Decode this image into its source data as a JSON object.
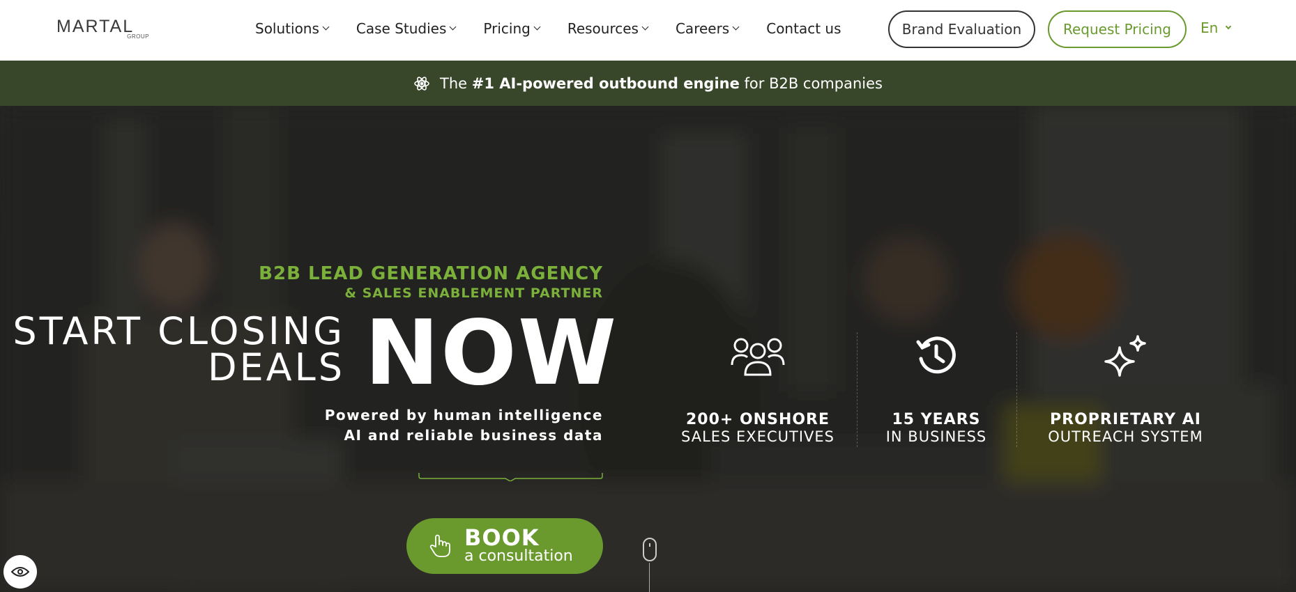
{
  "brand": {
    "logo_text": "MARTAL",
    "logo_sub": "GROUP"
  },
  "nav": {
    "items": [
      {
        "label": "Solutions",
        "has_dropdown": true
      },
      {
        "label": "Case Studies",
        "has_dropdown": true
      },
      {
        "label": "Pricing",
        "has_dropdown": true
      },
      {
        "label": "Resources",
        "has_dropdown": true
      },
      {
        "label": "Careers",
        "has_dropdown": true
      },
      {
        "label": "Contact us",
        "has_dropdown": false
      }
    ],
    "brand_evaluation": "Brand Evaluation",
    "request_pricing": "Request Pricing",
    "language": "En"
  },
  "announcement": {
    "prefix": "The",
    "bold": "#1 AI-powered outbound engine",
    "suffix": "for B2B companies"
  },
  "hero": {
    "tagline": "B2B LEAD GENERATION AGENCY",
    "subtagline": "& SALES ENABLEMENT PARTNER",
    "headline_line1": "START CLOSING",
    "headline_line2": "DEALS",
    "headline_big": "NOW",
    "powered_line1": "Powered by human intelligence",
    "powered_line2": "AI and reliable business data",
    "cta_title": "BOOK",
    "cta_subtitle": "a consultation"
  },
  "features": [
    {
      "line1": "200+ ONSHORE",
      "line2": "SALES EXECUTIVES",
      "icon": "team-icon"
    },
    {
      "line1": "15 YEARS",
      "line2": "IN BUSINESS",
      "icon": "clock-history-icon"
    },
    {
      "line1": "PROPRIETARY AI",
      "line2": "OUTREACH SYSTEM",
      "icon": "sparkle-icon"
    }
  ],
  "colors": {
    "accent": "#6a9a2e",
    "accent_text": "#7bb03a",
    "announcement_bg": "#38462a",
    "hero_bg": "#2a2a28"
  }
}
